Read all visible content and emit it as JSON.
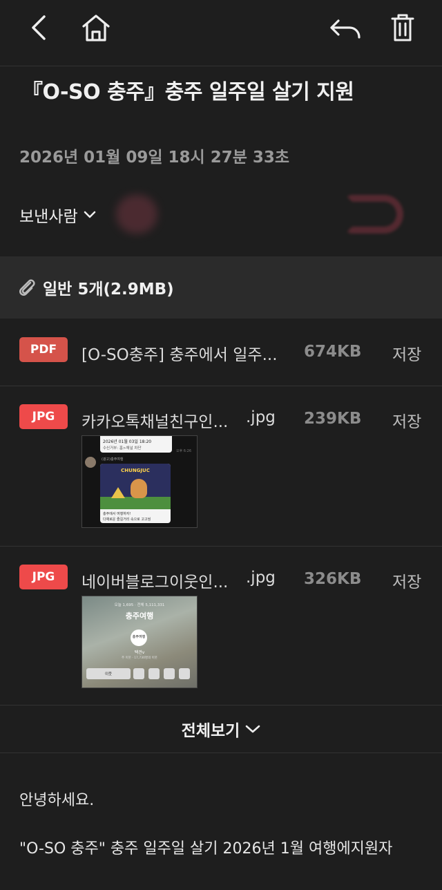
{
  "toolbar": {
    "back_icon": "back-chevron-icon",
    "home_icon": "home-icon",
    "reply_icon": "reply-icon",
    "delete_icon": "trash-icon"
  },
  "mail": {
    "subject": "『O-SO 충주』충주 일주일 살기 지원",
    "date": "2026년 01월 09일 18시 27분 33초",
    "sender_label": "보낸사람"
  },
  "attachments": {
    "header": "일반 5개(2.9MB)",
    "files": [
      {
        "type": "PDF",
        "name": "[O-SO충주] 충주에서 일주...",
        "ext": "",
        "size": "674KB",
        "save": "저장",
        "color": "#d5534a"
      },
      {
        "type": "JPG",
        "name": "카카오톡채널친구인...",
        "ext": ".jpg",
        "size": "239KB",
        "save": "저장",
        "color": "#ee4a4a"
      },
      {
        "type": "JPG",
        "name": "네이버블로그이웃인...",
        "ext": ".jpg",
        "size": "326KB",
        "save": "저장",
        "color": "#ee4a4a"
      }
    ],
    "thumb1": {
      "date": "2026년 01월 03일 18:20",
      "line2": "수신거부: 홈>채널 차단",
      "time": "오후 6:26",
      "sender": "(광고)충주여행",
      "banner": "CHUNGJUC",
      "msg1": "충주에서 여행하자!",
      "msg2": "다채로운 즐길거리 속으로 고고씽"
    },
    "thumb2": {
      "stats": "오늘 1,695 · 전체 5,111,331",
      "title": "충주여행",
      "logo": "충주여행",
      "user": "택견v",
      "meta": "주 이웃 · 17,730명의 이웃",
      "btn": "이웃"
    },
    "view_all": "전체보기"
  },
  "body": {
    "greeting": "안녕하세요.",
    "line1": "\"O-SO 충주\" 충주 일주일 살기 2026년 1월 여행에지원자"
  }
}
